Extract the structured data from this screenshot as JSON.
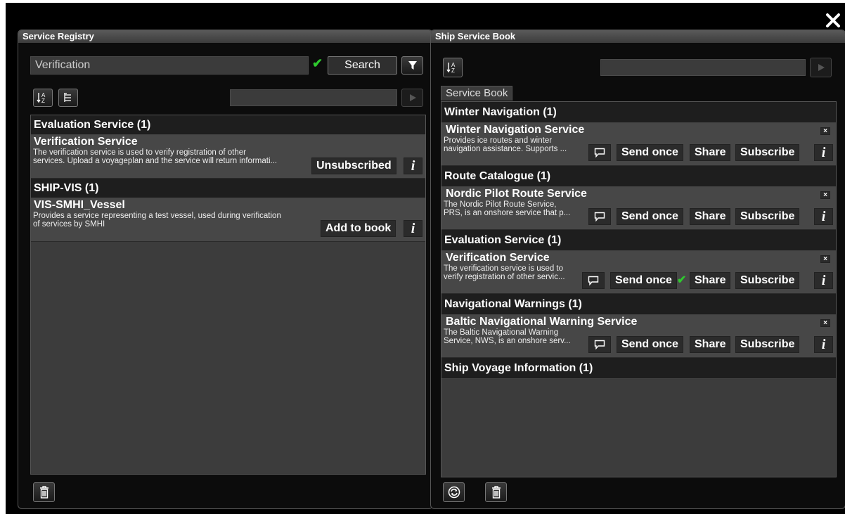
{
  "registry": {
    "title": "Service Registry",
    "search_value": "Verification",
    "search_button": "Search",
    "groups": [
      {
        "header": "Evaluation Service (1)",
        "services": [
          {
            "title": "Verification Service",
            "desc_line1": "The verification service is used to verify registration of other",
            "desc_line2": "services. Upload a voyageplan and the service will return informati...",
            "action": "Unsubscribed"
          }
        ]
      },
      {
        "header": "SHIP-VIS (1)",
        "services": [
          {
            "title": "VIS-SMHI_Vessel",
            "desc_line1": "Provides a service representing a test vessel, used during verification",
            "desc_line2": "of services by SMHI",
            "action": "Add to book"
          }
        ]
      }
    ]
  },
  "book": {
    "title": "Ship Service Book",
    "tab_label": "Service Book",
    "groups": [
      {
        "header": "Winter Navigation (1)",
        "service": {
          "title": "Winter Navigation Service",
          "desc_line1": "Provides ice routes and winter",
          "desc_line2": "navigation assistance. Supports ..."
        }
      },
      {
        "header": "Route Catalogue (1)",
        "service": {
          "title": "Nordic Pilot Route Service",
          "desc_line1": "The Nordic Pilot Route Service,",
          "desc_line2": "PRS, is an onshore service that p..."
        }
      },
      {
        "header": "Evaluation Service (1)",
        "service": {
          "title": "Verification Service",
          "desc_line1": "The verification service is used to",
          "desc_line2": "verify registration of other servic..."
        }
      },
      {
        "header": "Navigational Warnings (1)",
        "service": {
          "title": "Baltic Navigational Warning Service",
          "desc_line1": "The Baltic Navigational Warning",
          "desc_line2": "Service, NWS, is an onshore serv..."
        }
      },
      {
        "header": "Ship Voyage Information (1)"
      }
    ],
    "actions": {
      "send_once": "Send once",
      "share": "Share",
      "subscribe": "Subscribe"
    }
  },
  "icons": {
    "close": "close-icon",
    "filter": "filter-icon",
    "sort": "sort-az-icon",
    "tree": "tree-view-icon",
    "play": "play-icon",
    "trash": "trash-icon",
    "refresh": "refresh-icon",
    "chat": "chat-bubble-icon",
    "info": "info-icon",
    "check": "checkmark-icon"
  },
  "colors": {
    "check_green": "#2ec92e",
    "panel_bg": "#0c0c0c",
    "list_bg": "#3c3c3c",
    "service_bg": "#474747",
    "group_header_bg": "#1e1e1e"
  }
}
